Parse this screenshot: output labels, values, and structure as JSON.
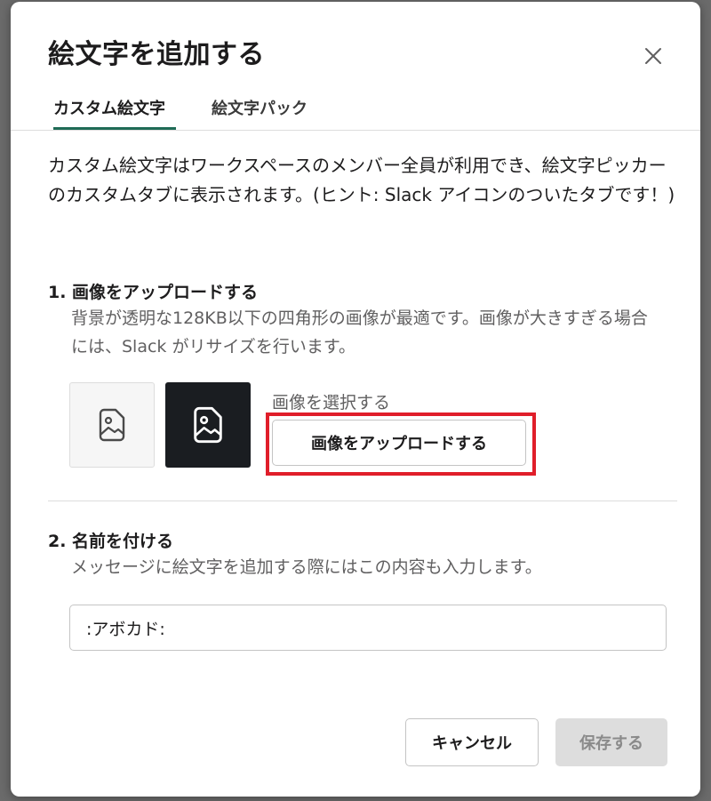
{
  "modal": {
    "title": "絵文字を追加する",
    "close_icon": "close-icon"
  },
  "tabs": [
    {
      "label": "カスタム絵文字",
      "active": true
    },
    {
      "label": "絵文字パック",
      "active": false
    }
  ],
  "description": "カスタム絵文字はワークスペースのメンバー全員が利用でき、絵文字ピッカーのカスタムタブに表示されます。(ヒント: Slack アイコンのついたタブです！)",
  "upload_section": {
    "title": "1. 画像をアップロードする",
    "description": "背景が透明な128KB以下の四角形の画像が最適です。画像が大きすぎる場合には、Slack がリサイズを行います。",
    "preview_icon": "image-placeholder-icon",
    "select_label": "画像を選択する",
    "button_label": "画像をアップロードする",
    "highlight_color": "#e01e2a"
  },
  "name_section": {
    "title": "2. 名前を付ける",
    "description": "メッセージに絵文字を追加する際にはこの内容も入力します。",
    "input_value": ":アボカド:"
  },
  "footer": {
    "cancel_label": "キャンセル",
    "save_label": "保存する"
  },
  "colors": {
    "tab_underline": "#1f6b56",
    "dark_preview_bg": "#1a1d21"
  }
}
